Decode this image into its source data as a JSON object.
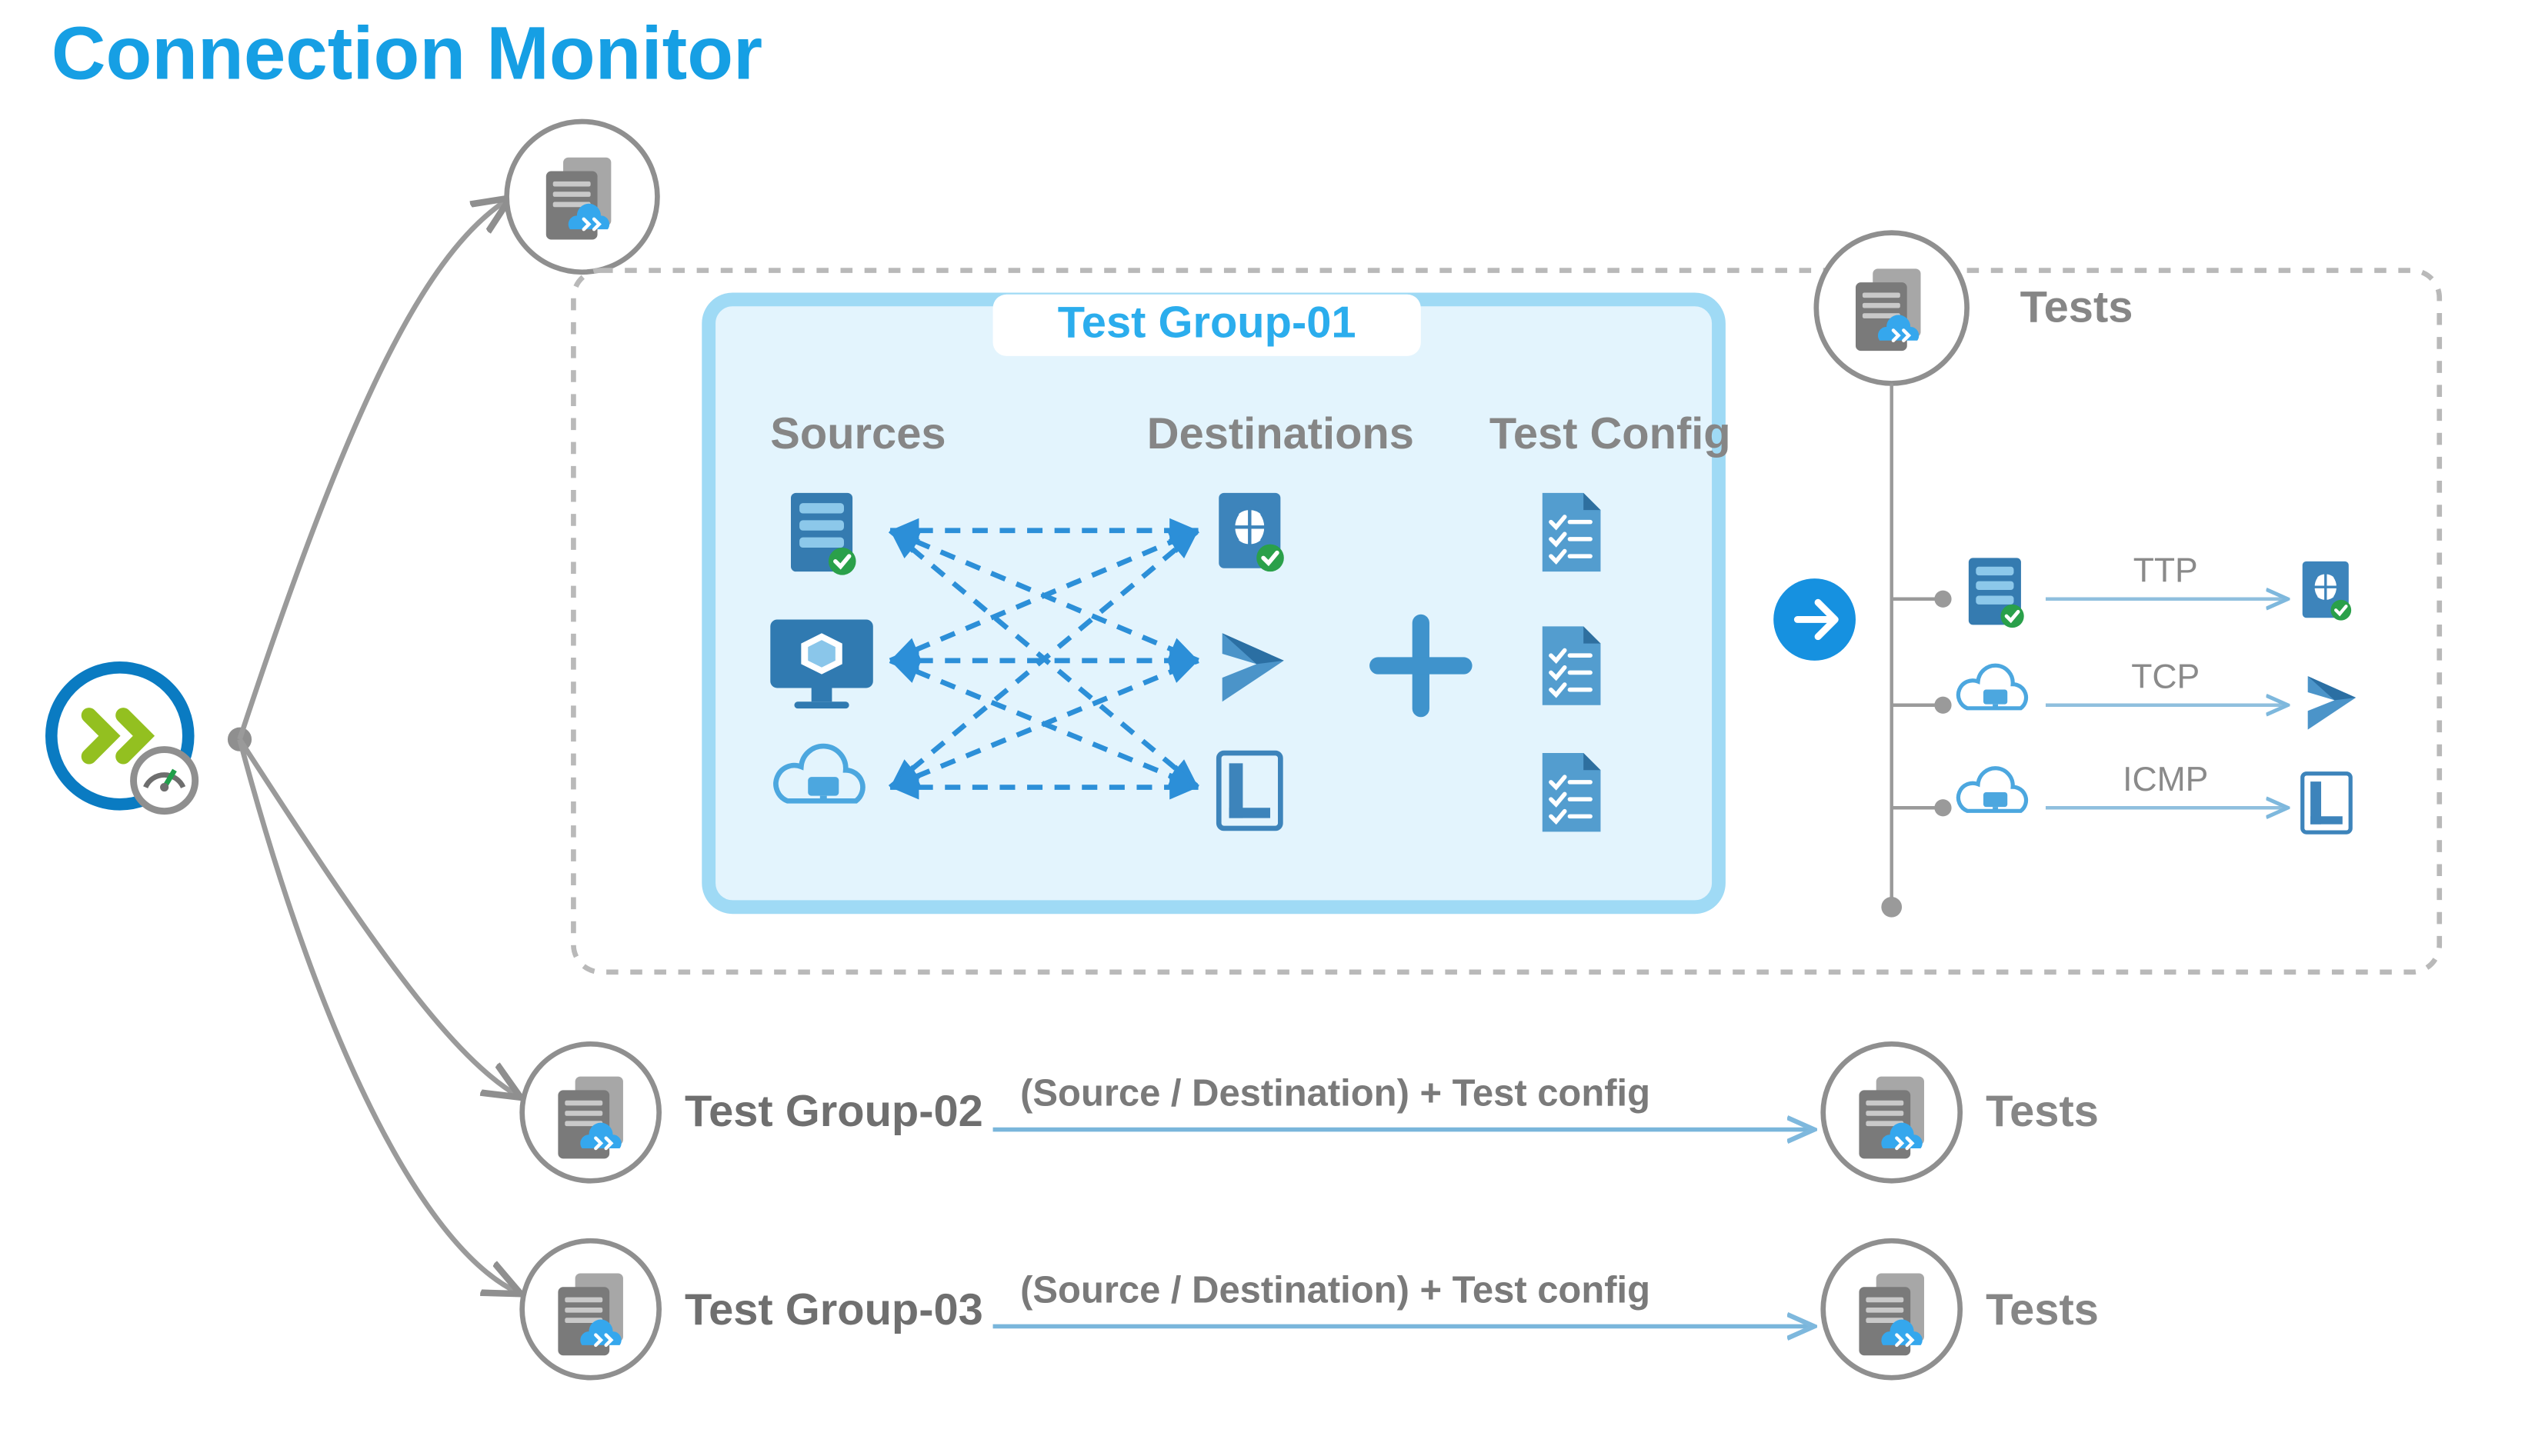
{
  "title": "Connection Monitor",
  "group1": {
    "title": "Test Group-01",
    "columns": {
      "sources": "Sources",
      "destinations": "Destinations",
      "config": "Test Config"
    }
  },
  "tests": {
    "heading": "Tests",
    "rows": [
      {
        "proto": "TTP"
      },
      {
        "proto": "TCP"
      },
      {
        "proto": "ICMP"
      }
    ]
  },
  "group2": {
    "label": "Test Group-02",
    "line": "(Source / Destination) + Test config",
    "tests": "Tests"
  },
  "group3": {
    "label": "Test Group-03",
    "line": "(Source / Destination) + Test config",
    "tests": "Tests"
  }
}
